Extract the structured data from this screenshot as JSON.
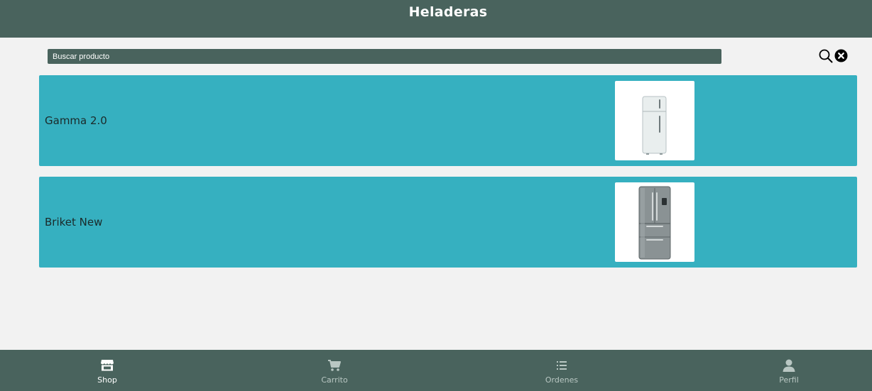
{
  "header": {
    "title": "Heladeras"
  },
  "search": {
    "placeholder": "Buscar producto"
  },
  "icons": {
    "search": "search-icon",
    "clear": "close-circle-icon"
  },
  "products": [
    {
      "name": "Gamma 2.0",
      "image": "white-refrigerator"
    },
    {
      "name": "Briket New",
      "image": "stainless-french-door-refrigerator"
    }
  ],
  "nav": {
    "items": [
      {
        "label": "Shop",
        "icon": "store-icon",
        "active": true
      },
      {
        "label": "Carrito",
        "icon": "cart-icon",
        "active": false
      },
      {
        "label": "Ordenes",
        "icon": "list-icon",
        "active": false
      },
      {
        "label": "Perfil",
        "icon": "user-icon",
        "active": false
      }
    ]
  },
  "colors": {
    "header": "#49635d",
    "background": "#f2f2f2",
    "card": "#36b0c0",
    "nav_active": "#ffffff",
    "nav_inactive": "#b9c7c3"
  }
}
